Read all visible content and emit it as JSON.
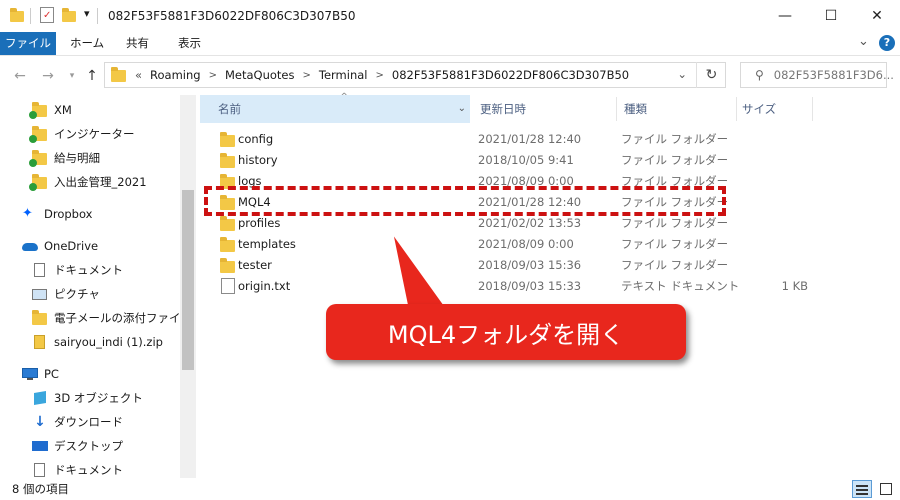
{
  "window": {
    "title": "082F53F5881F3D6022DF806C3D307B50",
    "minimize": "—",
    "maximize": "☐",
    "close": "✕"
  },
  "ribbon": {
    "tabs": [
      "ファイル",
      "ホーム",
      "共有",
      "表示"
    ],
    "expand": "⌄",
    "help": "?"
  },
  "address": {
    "overflow": "«",
    "crumbs": [
      "Roaming",
      "MetaQuotes",
      "Terminal",
      "082F53F5881F3D6022DF806C3D307B50"
    ],
    "dropdown": "⌄"
  },
  "search": {
    "placeholder": "082F53F5881F3D6..."
  },
  "sidebar": {
    "items": [
      {
        "label": "XM",
        "icon": "folder-synced-icon"
      },
      {
        "label": "インジケーター",
        "icon": "folder-synced-icon"
      },
      {
        "label": "給与明細",
        "icon": "folder-synced-icon"
      },
      {
        "label": "入出金管理_2021",
        "icon": "folder-synced-icon"
      },
      {
        "label": "Dropbox",
        "icon": "dropbox-icon"
      },
      {
        "label": "OneDrive",
        "icon": "onedrive-icon"
      },
      {
        "label": "ドキュメント",
        "icon": "document-icon"
      },
      {
        "label": "ピクチャ",
        "icon": "picture-icon"
      },
      {
        "label": "電子メールの添付ファイル",
        "icon": "folder-icon"
      },
      {
        "label": "sairyou_indi (1).zip",
        "icon": "zip-icon"
      },
      {
        "label": "PC",
        "icon": "pc-icon"
      },
      {
        "label": "3D オブジェクト",
        "icon": "3d-objects-icon"
      },
      {
        "label": "ダウンロード",
        "icon": "download-icon"
      },
      {
        "label": "デスクトップ",
        "icon": "desktop-icon"
      },
      {
        "label": "ドキュメント",
        "icon": "document-icon"
      }
    ]
  },
  "columns": {
    "name": "名前",
    "date": "更新日時",
    "type": "種類",
    "size": "サイズ"
  },
  "files": [
    {
      "name": "config",
      "date": "2021/01/28 12:40",
      "type": "ファイル フォルダー",
      "size": "",
      "kind": "folder"
    },
    {
      "name": "history",
      "date": "2018/10/05 9:41",
      "type": "ファイル フォルダー",
      "size": "",
      "kind": "folder"
    },
    {
      "name": "logs",
      "date": "2021/08/09 0:00",
      "type": "ファイル フォルダー",
      "size": "",
      "kind": "folder"
    },
    {
      "name": "MQL4",
      "date": "2021/01/28 12:40",
      "type": "ファイル フォルダー",
      "size": "",
      "kind": "folder"
    },
    {
      "name": "profiles",
      "date": "2021/02/02 13:53",
      "type": "ファイル フォルダー",
      "size": "",
      "kind": "folder"
    },
    {
      "name": "templates",
      "date": "2021/08/09 0:00",
      "type": "ファイル フォルダー",
      "size": "",
      "kind": "folder"
    },
    {
      "name": "tester",
      "date": "2018/09/03 15:36",
      "type": "ファイル フォルダー",
      "size": "",
      "kind": "folder"
    },
    {
      "name": "origin.txt",
      "date": "2018/09/03 15:33",
      "type": "テキスト ドキュメント",
      "size": "1 KB",
      "kind": "file"
    }
  ],
  "annotation": {
    "callout": "MQL4フォルダを開く",
    "highlight_color": "#cc1111",
    "callout_color": "#e8271d"
  },
  "status": {
    "count": "8 個の項目"
  },
  "colors": {
    "accent": "#1a6fb9",
    "folder": "#f3c846"
  }
}
